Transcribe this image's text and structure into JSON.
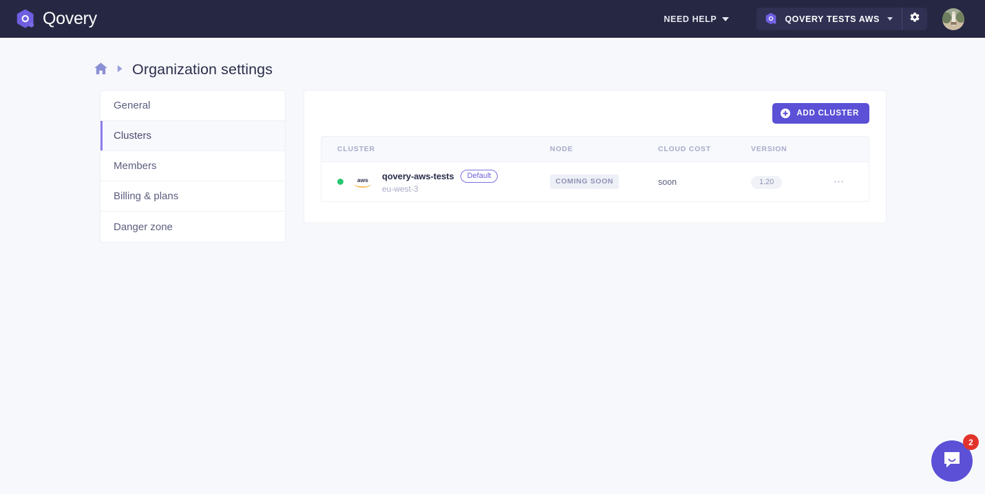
{
  "navbar": {
    "brand_name": "Qovery",
    "brand_logo_icon": "qovery-logo-icon",
    "need_help_label": "NEED HELP",
    "need_help_caret_icon": "chevron-down-icon",
    "org_logo_icon": "qovery-mark-icon",
    "org_name": "QOVERY TESTS AWS",
    "org_caret_icon": "chevron-down-icon",
    "settings_icon": "gear-icon",
    "avatar_icon": "user-avatar-photo",
    "bg_color": "#262742",
    "pill_color": "#2f3052"
  },
  "breadcrumb": {
    "home_icon": "home-icon",
    "separator_icon": "chevron-right-icon",
    "title": "Organization settings"
  },
  "sidebar": {
    "items": [
      {
        "label": "General",
        "active": false
      },
      {
        "label": "Clusters",
        "active": true
      },
      {
        "label": "Members",
        "active": false
      },
      {
        "label": "Billing & plans",
        "active": false
      },
      {
        "label": "Danger zone",
        "active": false
      }
    ],
    "active_indicator_color": "#8e7aec"
  },
  "main": {
    "add_cluster_label": "ADD CLUSTER",
    "add_cluster_icon": "plus-circle-icon",
    "accent_color": "#5b50d6",
    "table": {
      "columns": [
        {
          "key": "cluster",
          "label": "CLUSTER"
        },
        {
          "key": "node",
          "label": "NODE"
        },
        {
          "key": "cloud_cost",
          "label": "CLOUD COST"
        },
        {
          "key": "version",
          "label": "VERSION"
        }
      ],
      "rows": [
        {
          "status": "running",
          "status_color": "#28c76f",
          "provider_icon": "aws-logo-icon",
          "name": "qovery-aws-tests",
          "badge": "Default",
          "region": "eu-west-3",
          "node": "COMING SOON",
          "cloud_cost": "soon",
          "version": "1.20",
          "menu_icon": "ellipsis-horizontal-icon"
        }
      ]
    }
  },
  "chat": {
    "icon": "chat-bubble-icon",
    "unread_count": "2",
    "badge_color": "#e2342c",
    "button_color": "#5b50d6"
  }
}
